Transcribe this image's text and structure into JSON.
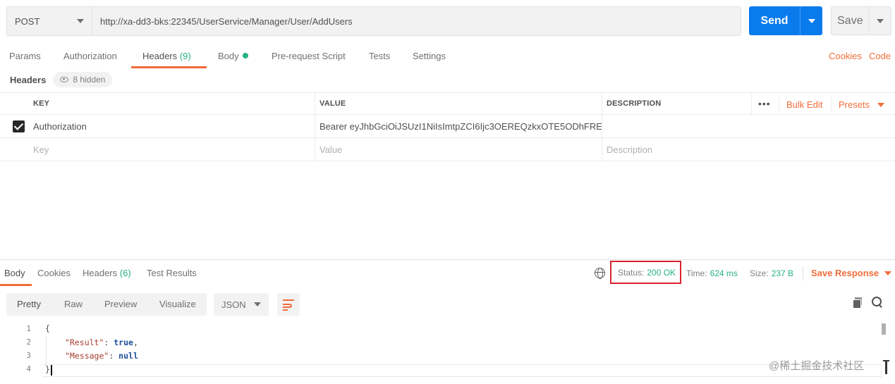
{
  "request": {
    "method": "POST",
    "url": "http://xa-dd3-bks:22345/UserService/Manager/User/AddUsers",
    "send_label": "Send",
    "save_label": "Save"
  },
  "request_tabs": {
    "params": "Params",
    "authorization": "Authorization",
    "headers": "Headers",
    "headers_count": "(9)",
    "body": "Body",
    "pre_request": "Pre-request Script",
    "tests": "Tests",
    "settings": "Settings",
    "cookies_link": "Cookies",
    "code_link": "Code"
  },
  "headers_section": {
    "title": "Headers",
    "hidden": "8 hidden"
  },
  "headers_table": {
    "columns": [
      "KEY",
      "VALUE",
      "DESCRIPTION"
    ],
    "bulk_edit": "Bulk Edit",
    "presets": "Presets",
    "rows": [
      {
        "checked": true,
        "key": "Authorization",
        "value": "Bearer eyJhbGciOiJSUzI1NiIsImtpZCI6Ijc3OEREQzkxOTE5ODhFRE...",
        "description": ""
      }
    ],
    "placeholder": {
      "key": "Key",
      "value": "Value",
      "description": "Description"
    }
  },
  "response_tabs": {
    "body": "Body",
    "cookies": "Cookies",
    "headers": "Headers",
    "headers_count": "(6)",
    "test_results": "Test Results"
  },
  "response_meta": {
    "status_label": "Status:",
    "status_value": "200 OK",
    "time_label": "Time:",
    "time_value": "624 ms",
    "size_label": "Size:",
    "size_value": "237 B",
    "save_response": "Save Response"
  },
  "view_modes": {
    "pretty": "Pretty",
    "raw": "Raw",
    "preview": "Preview",
    "visualize": "Visualize",
    "format": "JSON"
  },
  "editor": {
    "line_numbers": [
      "1",
      "2",
      "3",
      "4"
    ],
    "open_brace": "{",
    "result_key": "\"Result\"",
    "result_value": "true",
    "message_key": "\"Message\"",
    "message_value": "null",
    "close_brace": "}"
  },
  "watermark": "@稀土掘金技术社区",
  "colors": {
    "accent_orange": "#f26b3a",
    "send_blue": "#097bed",
    "status_green": "#26b47f",
    "highlight_red": "#d9232e"
  }
}
